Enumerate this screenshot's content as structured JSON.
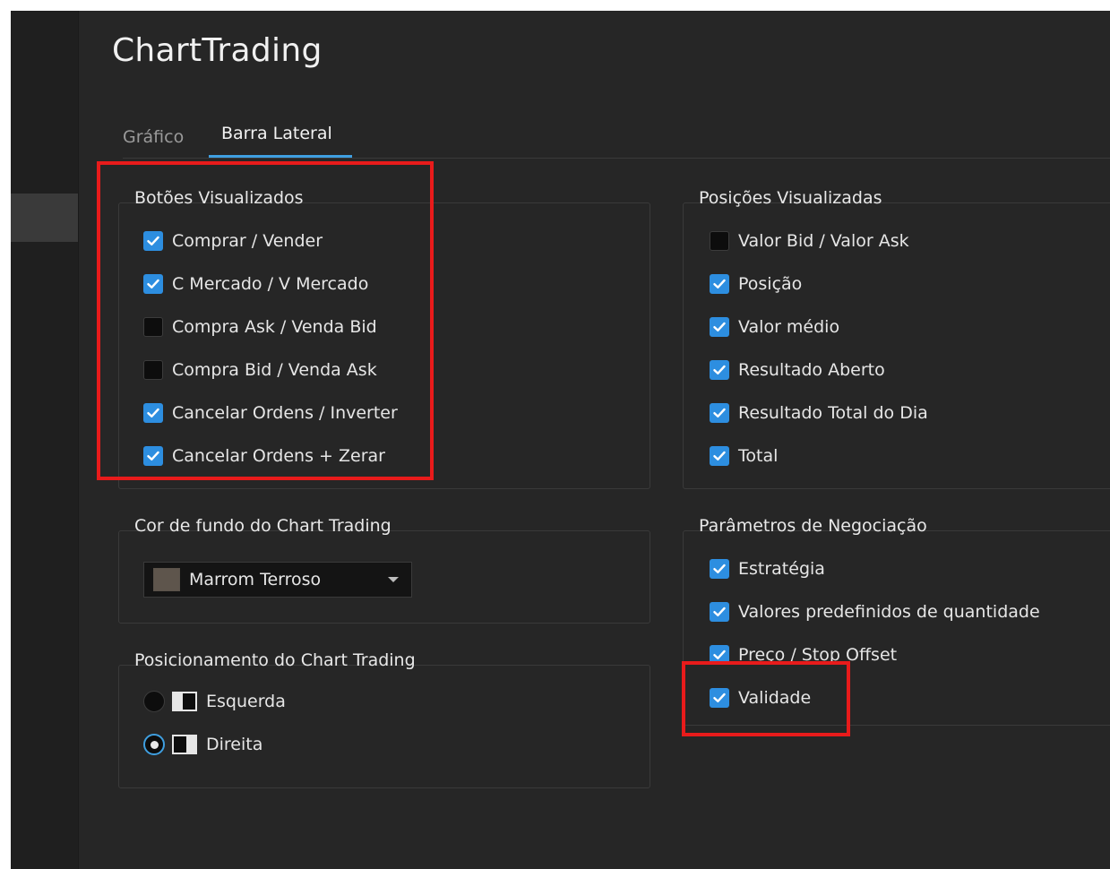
{
  "window": {
    "title": "ChartTrading"
  },
  "tabs": [
    {
      "label": "Gráfico",
      "active": false
    },
    {
      "label": "Barra Lateral",
      "active": true
    }
  ],
  "botoes_visualizados": {
    "title": "Botões Visualizados",
    "items": [
      {
        "label": "Comprar / Vender",
        "checked": true
      },
      {
        "label": "C Mercado / V Mercado",
        "checked": true
      },
      {
        "label": "Compra Ask /  Venda Bid",
        "checked": false
      },
      {
        "label": "Compra Bid / Venda Ask",
        "checked": false
      },
      {
        "label": "Cancelar Ordens / Inverter",
        "checked": true
      },
      {
        "label": "Cancelar Ordens + Zerar",
        "checked": true
      }
    ]
  },
  "posicoes_visualizadas": {
    "title": "Posições Visualizadas",
    "items": [
      {
        "label": "Valor Bid / Valor Ask",
        "checked": false
      },
      {
        "label": "Posição",
        "checked": true
      },
      {
        "label": "Valor médio",
        "checked": true
      },
      {
        "label": "Resultado Aberto",
        "checked": true
      },
      {
        "label": "Resultado Total do Dia",
        "checked": true
      },
      {
        "label": "Total",
        "checked": true
      }
    ]
  },
  "cor_de_fundo": {
    "title": "Cor de fundo do Chart Trading",
    "selected": "Marrom Terroso",
    "swatch_color": "#5e554c"
  },
  "parametros": {
    "title": "Parâmetros de Negociação",
    "items": [
      {
        "label": "Estratégia",
        "checked": true
      },
      {
        "label": "Valores predefinidos de quantidade",
        "checked": true
      },
      {
        "label": "Preço / Stop Offset",
        "checked": true
      },
      {
        "label": "Validade",
        "checked": true
      }
    ]
  },
  "posicionamento": {
    "title": "Posicionamento do Chart Trading",
    "options": [
      {
        "label": "Esquerda",
        "selected": false
      },
      {
        "label": "Direita",
        "selected": true
      }
    ]
  },
  "colors": {
    "accent": "#2d8ee0",
    "highlight": "#e81b1b",
    "background": "#262626"
  }
}
